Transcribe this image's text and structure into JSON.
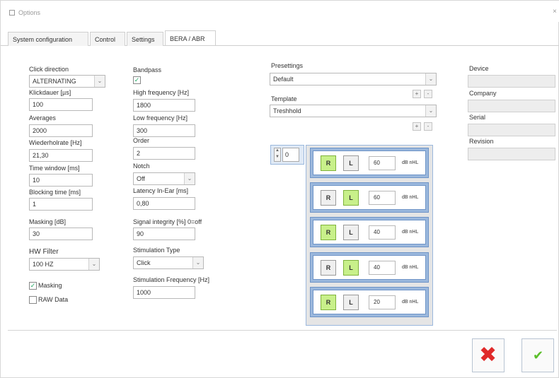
{
  "window": {
    "title": "Options",
    "close_glyph": "×"
  },
  "tabs": [
    {
      "label": "System configuration"
    },
    {
      "label": "Control"
    },
    {
      "label": "Settings"
    },
    {
      "label": "BERA / ABR"
    }
  ],
  "col1": {
    "click_direction": {
      "label": "Click direction",
      "value": "ALTERNATING"
    },
    "klickdauer": {
      "label": "Klickdauer [µs]",
      "value": "100"
    },
    "averages": {
      "label": "Averages",
      "value": "2000"
    },
    "wiederholrate": {
      "label": "Wiederholrate [Hz]",
      "value": "21,30"
    },
    "time_window": {
      "label": "Time window [ms]",
      "value": "10"
    },
    "blocking_time": {
      "label": "Blocking time [ms]",
      "value": "1"
    },
    "masking_db": {
      "label": "Masking [dB]",
      "value": "30"
    },
    "hw_filter": {
      "label": "HW Filter",
      "value": "100 HZ"
    },
    "masking_chk": {
      "label": "Masking",
      "checked": "✓"
    },
    "raw_data_chk": {
      "label": "RAW Data"
    }
  },
  "col2": {
    "bandpass": {
      "label": "Bandpass",
      "checked": "✓"
    },
    "high_freq": {
      "label": "High frequency [Hz]",
      "value": "1800"
    },
    "low_freq": {
      "label": "Low frequency [Hz]",
      "value": "300"
    },
    "order": {
      "label": "Order",
      "value": "2"
    },
    "notch": {
      "label": "Notch",
      "value": "Off"
    },
    "latency": {
      "label": "Latency In-Ear [ms]",
      "value": "0,80"
    },
    "signal_integrity": {
      "label": "Signal integrity [%] 0=off",
      "value": "90"
    },
    "stim_type": {
      "label": "Stimulation Type",
      "value": "Click"
    },
    "stim_freq": {
      "label": "Stimulation Frequency [Hz]",
      "value": "1000"
    }
  },
  "presettings": {
    "label": "Presettings",
    "value": "Default"
  },
  "template": {
    "label": "Template",
    "value": "Treshhold"
  },
  "small_buttons": {
    "plus": "+",
    "minus": "-"
  },
  "counter": {
    "value": "0",
    "up": "▲",
    "down": "▼"
  },
  "dropdown_glyph": "⌄",
  "stim_rows": [
    {
      "right": "R",
      "left": "L",
      "active": "R",
      "db": "60",
      "unit": "dB nHL"
    },
    {
      "right": "R",
      "left": "L",
      "active": "L",
      "db": "60",
      "unit": "dB nHL"
    },
    {
      "right": "R",
      "left": "L",
      "active": "R",
      "db": "40",
      "unit": "dB nHL"
    },
    {
      "right": "R",
      "left": "L",
      "active": "L",
      "db": "40",
      "unit": "dB nHL"
    },
    {
      "right": "R",
      "left": "L",
      "active": "R",
      "db": "20",
      "unit": "dB nHL"
    }
  ],
  "device_info": {
    "device": {
      "label": "Device",
      "value": ""
    },
    "company": {
      "label": "Company",
      "value": ""
    },
    "serial": {
      "label": "Serial",
      "value": ""
    },
    "revision": {
      "label": "Revision",
      "value": ""
    }
  },
  "footer": {
    "cancel_glyph": "✖",
    "ok_glyph": "✔"
  },
  "colors": {
    "accent_green": "#c8f08a",
    "row_blue": "#9bb8dd",
    "cancel_red": "#e02a2a",
    "ok_green": "#5bbf2a"
  }
}
